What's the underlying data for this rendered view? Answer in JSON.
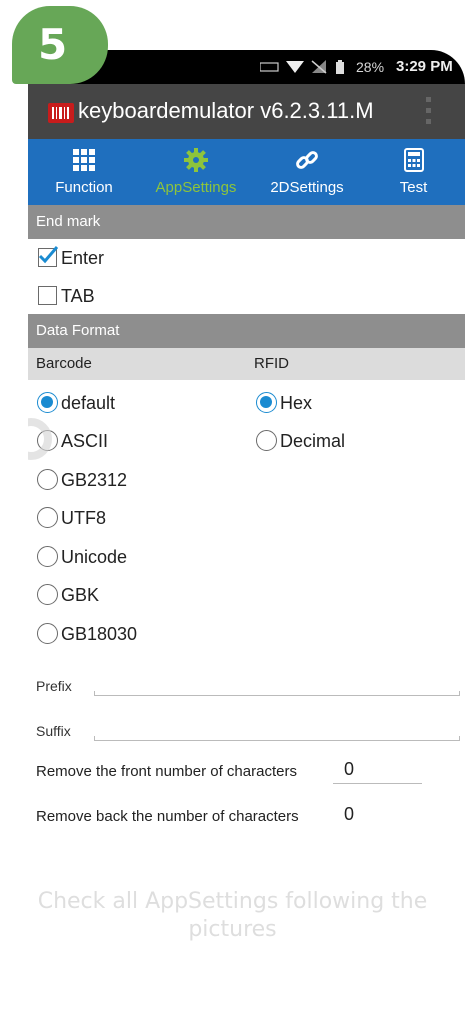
{
  "step_badge": "5",
  "statusbar": {
    "battery_percent": "28%",
    "time": "3:29 PM"
  },
  "actionbar": {
    "title": "keyboardemulator v6.2.3.11.M"
  },
  "tabs": [
    {
      "label": "Function",
      "icon": "grid-icon"
    },
    {
      "label": "AppSettings",
      "icon": "gear-icon"
    },
    {
      "label": "2DSettings",
      "icon": "link-icon"
    },
    {
      "label": "Test",
      "icon": "calculator-icon"
    }
  ],
  "active_tab": "AppSettings",
  "end_mark": {
    "header": "End mark",
    "options": [
      {
        "label": "Enter",
        "checked": true
      },
      {
        "label": "TAB",
        "checked": false
      }
    ]
  },
  "data_format": {
    "header": "Data Format",
    "barcode_label": "Barcode",
    "rfid_label": "RFID",
    "barcode_options": [
      "default",
      "ASCII",
      "GB2312",
      "UTF8",
      "Unicode",
      "GBK",
      "GB18030"
    ],
    "barcode_selected": "default",
    "rfid_options": [
      "Hex",
      "Decimal"
    ],
    "rfid_selected": "Hex"
  },
  "prefix": {
    "label": "Prefix",
    "value": ""
  },
  "suffix": {
    "label": "Suffix",
    "value": ""
  },
  "remove_front": {
    "label": "Remove the front number of characters",
    "value": "0"
  },
  "remove_back": {
    "label": "Remove back the number of characters",
    "value": "0"
  },
  "caption": "Check all AppSettings following the pictures",
  "colors": {
    "badge": "#67a757",
    "tabbar": "#1f6fbe",
    "active_tab": "#8dc43c",
    "radio_on": "#1a8bd1"
  }
}
